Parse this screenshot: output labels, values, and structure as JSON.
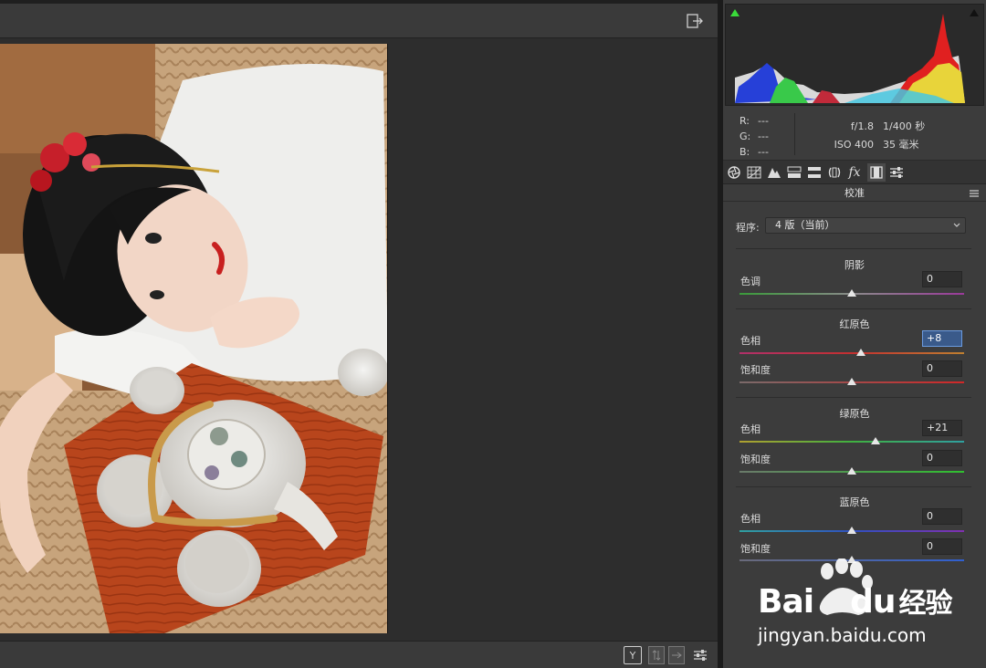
{
  "histogram": {
    "shadow_clip_color": "#3adb3a"
  },
  "info": {
    "r_label": "R:",
    "r_value": "---",
    "g_label": "G:",
    "g_value": "---",
    "b_label": "B:",
    "b_value": "---",
    "aperture": "f/1.8",
    "shutter": "1/400 秒",
    "iso": "ISO 400",
    "focal": "35 毫米"
  },
  "tabs": [
    {
      "icon": "aperture-icon"
    },
    {
      "icon": "tone-curve-icon"
    },
    {
      "icon": "detail-icon"
    },
    {
      "icon": "hsl-icon"
    },
    {
      "icon": "split-toning-icon"
    },
    {
      "icon": "lens-icon"
    },
    {
      "icon": "effects-icon",
      "label": "fx"
    },
    {
      "icon": "calibration-icon"
    },
    {
      "icon": "presets-icon"
    }
  ],
  "panel": {
    "title": "校准",
    "program_label": "程序:",
    "program_value": "4 版（当前）",
    "shadows": {
      "title": "阴影",
      "tint_label": "色调",
      "tint_value": "0",
      "tint_level": 0
    },
    "red": {
      "title": "红原色",
      "hue_label": "色相",
      "hue_value": "+8",
      "hue_level": 8,
      "sat_label": "饱和度",
      "sat_value": "0",
      "sat_level": 0
    },
    "green": {
      "title": "绿原色",
      "hue_label": "色相",
      "hue_value": "+21",
      "hue_level": 21,
      "sat_label": "饱和度",
      "sat_value": "0",
      "sat_level": 0
    },
    "blue": {
      "title": "蓝原色",
      "hue_label": "色相",
      "hue_value": "0",
      "hue_level": 0,
      "sat_label": "饱和度",
      "sat_value": "0",
      "sat_level": 0
    }
  },
  "bottombar": {
    "compare_label": "Y"
  },
  "watermark": {
    "brand": "Bai",
    "brand2": "du",
    "cn": "经验",
    "url": "jingyan.baidu.com"
  }
}
